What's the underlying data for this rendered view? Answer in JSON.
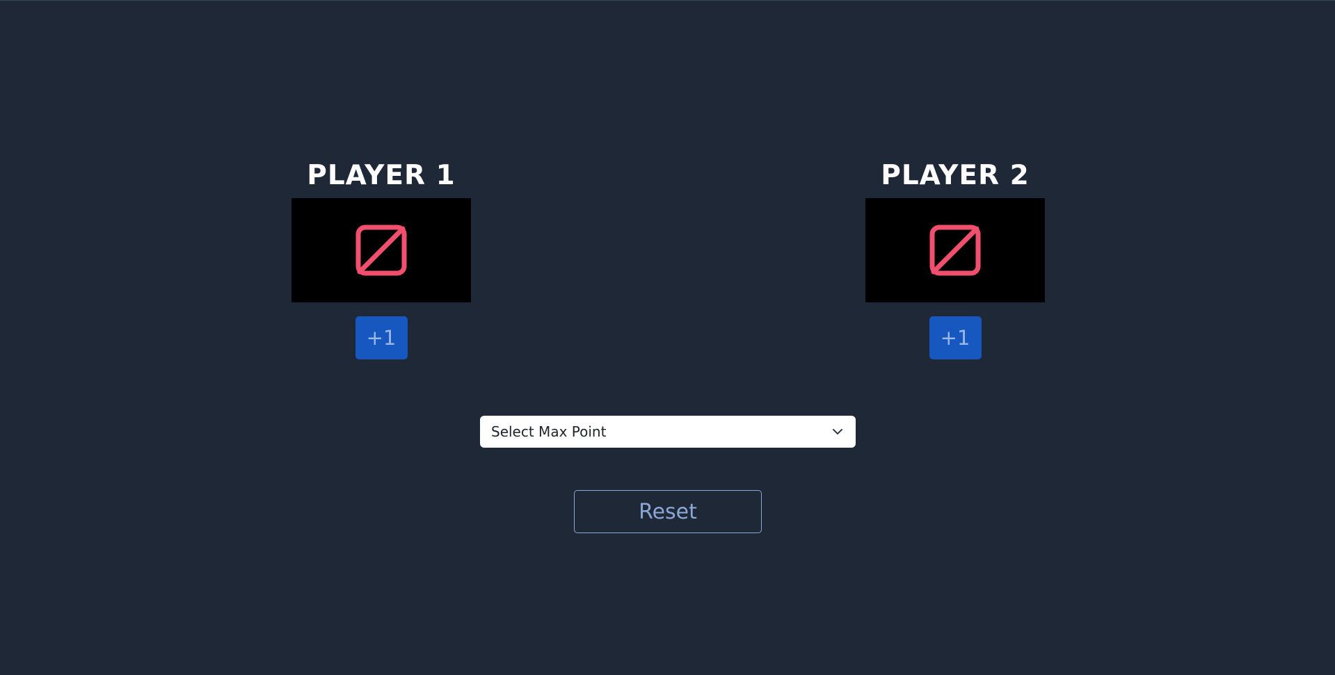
{
  "players": [
    {
      "title": "PLAYER 1",
      "score_icon": "empty-set-icon",
      "increment_label": "+1"
    },
    {
      "title": "PLAYER 2",
      "score_icon": "empty-set-icon",
      "increment_label": "+1"
    }
  ],
  "max_point_select": {
    "selected": "Select Max Point",
    "icon": "chevron-down-icon"
  },
  "reset_label": "Reset",
  "colors": {
    "background": "#1f2837",
    "score_background": "#000000",
    "score_icon": "#f0506e",
    "primary_button": "#1657c0",
    "outline_button": "#8aa7d6"
  }
}
